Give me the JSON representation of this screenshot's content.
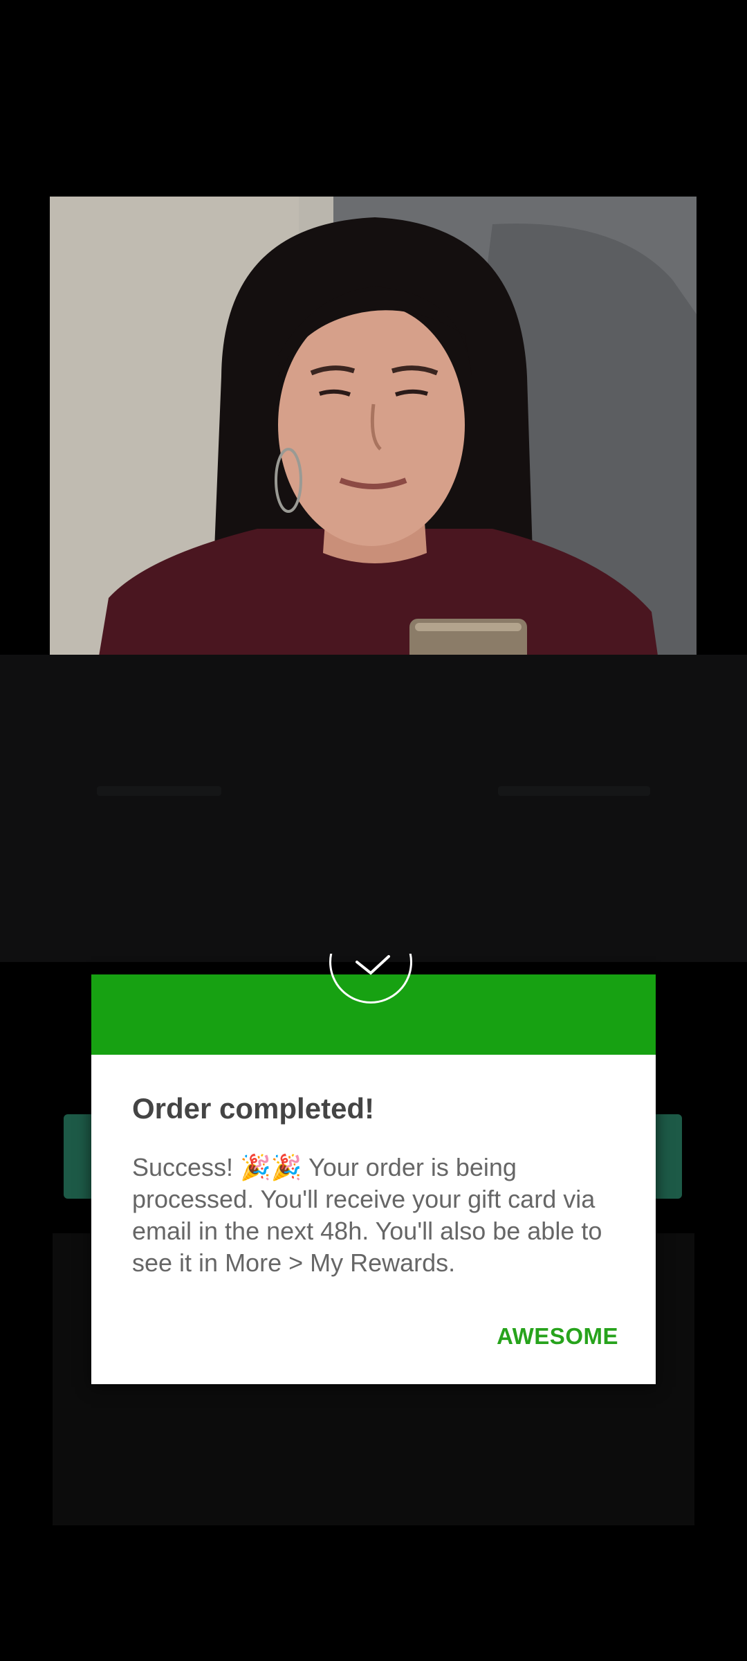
{
  "dialog": {
    "title": "Order completed!",
    "message": "Success! 🎉🎉 Your order is being processed. You'll receive your gift card via email in the next 48h. You'll also be able to see it in More > My Rewards.",
    "confirm_label": "AWESOME",
    "header_color": "#17a112",
    "button_color": "#27a31c"
  },
  "icons": {
    "success": "checkmark-icon"
  }
}
